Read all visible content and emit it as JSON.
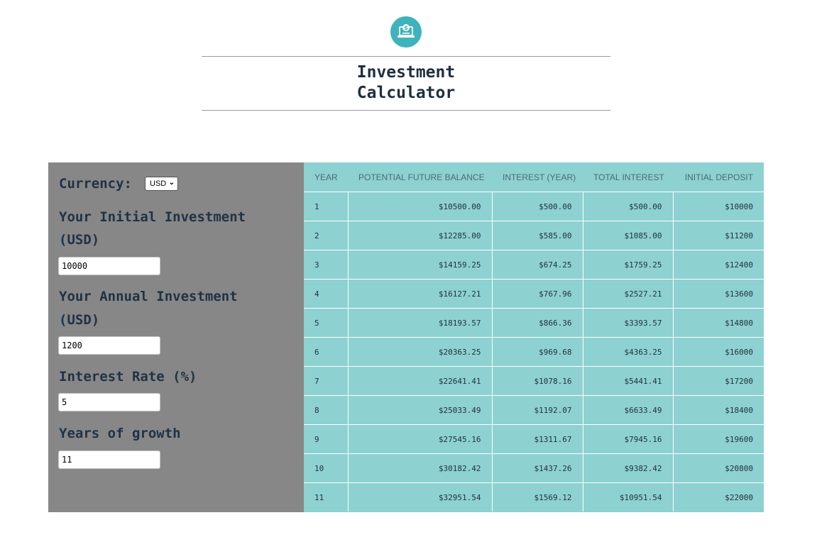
{
  "header": {
    "title_line1": "Investment",
    "title_line2": "Calculator",
    "logo_icon": "laptop-dollar-icon",
    "logo_color": "#3fb3bb"
  },
  "form": {
    "currency_label": "Currency:",
    "currency_value": "USD",
    "initial_label_line1": "Your Initial Investment",
    "initial_label_line2": "(USD)",
    "initial_value": "10000",
    "annual_label_line1": "Your Annual Investment",
    "annual_label_line2": "(USD)",
    "annual_value": "1200",
    "rate_label": "Interest Rate (%)",
    "rate_value": "5",
    "years_label": "Years of growth",
    "years_value": "11",
    "panel_color": "#878787"
  },
  "table": {
    "bg_color": "#8dd1d1",
    "headers": [
      "YEAR",
      "POTENTIAL FUTURE BALANCE",
      "INTEREST (YEAR)",
      "TOTAL INTEREST",
      "INITIAL DEPOSIT"
    ],
    "rows": [
      [
        "1",
        "$10500.00",
        "$500.00",
        "$500.00",
        "$10000"
      ],
      [
        "2",
        "$12285.00",
        "$585.00",
        "$1085.00",
        "$11200"
      ],
      [
        "3",
        "$14159.25",
        "$674.25",
        "$1759.25",
        "$12400"
      ],
      [
        "4",
        "$16127.21",
        "$767.96",
        "$2527.21",
        "$13600"
      ],
      [
        "5",
        "$18193.57",
        "$866.36",
        "$3393.57",
        "$14800"
      ],
      [
        "6",
        "$20363.25",
        "$969.68",
        "$4363.25",
        "$16000"
      ],
      [
        "7",
        "$22641.41",
        "$1078.16",
        "$5441.41",
        "$17200"
      ],
      [
        "8",
        "$25033.49",
        "$1192.07",
        "$6633.49",
        "$18400"
      ],
      [
        "9",
        "$27545.16",
        "$1311.67",
        "$7945.16",
        "$19600"
      ],
      [
        "10",
        "$30182.42",
        "$1437.26",
        "$9382.42",
        "$20800"
      ],
      [
        "11",
        "$32951.54",
        "$1569.12",
        "$10951.54",
        "$22000"
      ]
    ]
  }
}
